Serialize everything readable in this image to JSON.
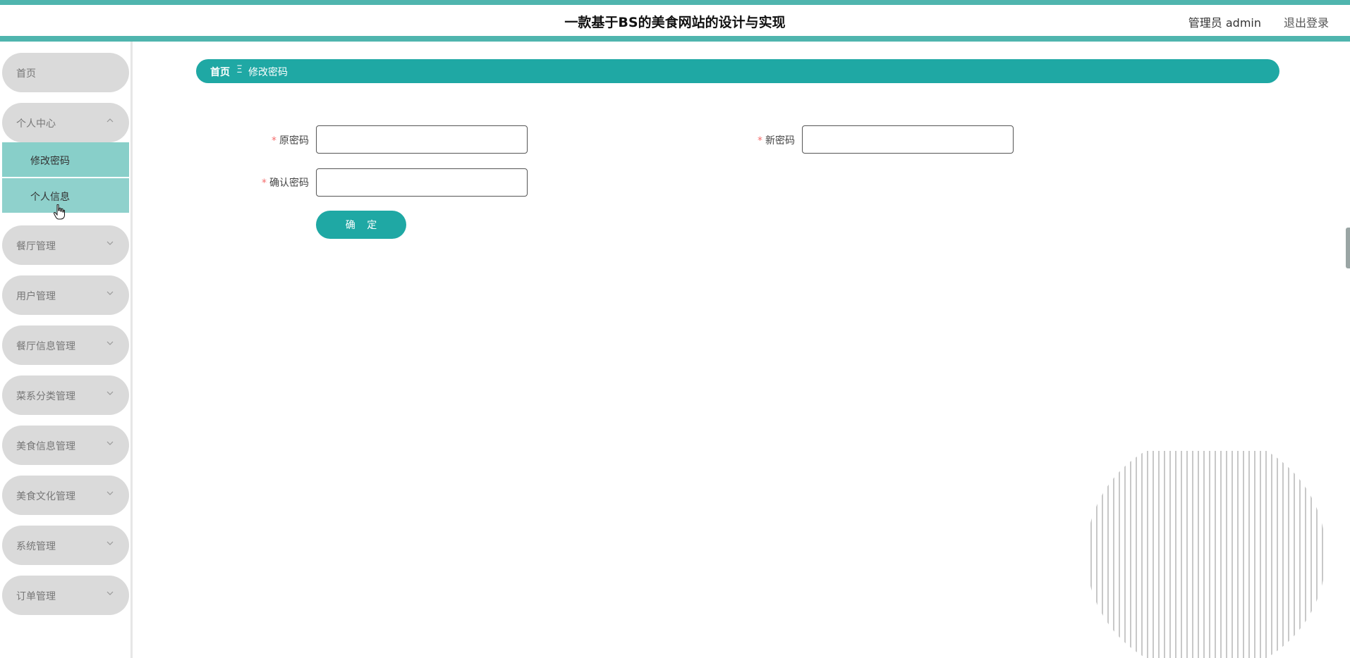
{
  "header": {
    "title": "一款基于BS的美食网站的设计与实现",
    "user": "管理员 admin",
    "logout": "退出登录"
  },
  "sidebar": {
    "items": [
      {
        "label": "首页"
      },
      {
        "label": "个人中心",
        "expanded": true,
        "children": [
          {
            "label": "修改密码",
            "active": true
          },
          {
            "label": "个人信息"
          }
        ]
      },
      {
        "label": "餐厅管理"
      },
      {
        "label": "用户管理"
      },
      {
        "label": "餐厅信息管理"
      },
      {
        "label": "菜系分类管理"
      },
      {
        "label": "美食信息管理"
      },
      {
        "label": "美食文化管理"
      },
      {
        "label": "系统管理"
      },
      {
        "label": "订单管理"
      }
    ]
  },
  "breadcrumb": {
    "home": "首页",
    "separator": "Ξ",
    "current": "修改密码"
  },
  "form": {
    "required_mark": "*",
    "old_password": {
      "label": "原密码",
      "value": ""
    },
    "new_password": {
      "label": "新密码",
      "value": ""
    },
    "confirm_password": {
      "label": "确认密码",
      "value": ""
    },
    "submit": "确 定"
  },
  "colors": {
    "accent": "#1fa8a4",
    "header_border": "#4fb5ae",
    "submenu": "#8fd1cc",
    "pill": "#dadada",
    "required": "#f56c6c"
  }
}
